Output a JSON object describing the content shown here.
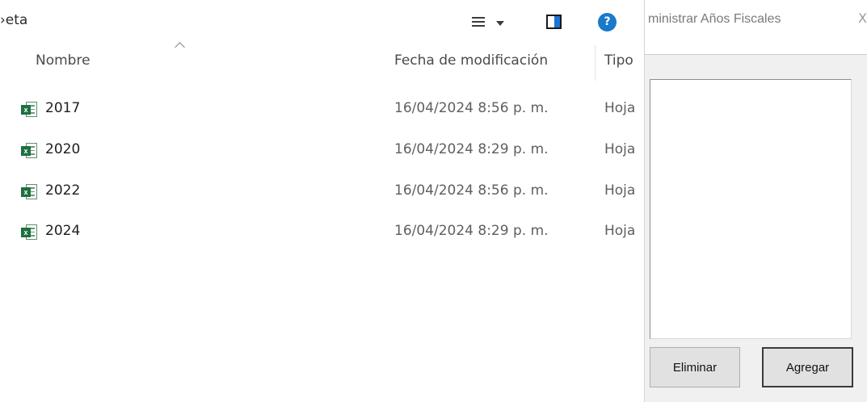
{
  "explorer": {
    "breadcrumb_fragment": "›eta",
    "toolbar": {
      "view_menu_icon": "list-view-icon",
      "preview_pane_icon": "preview-pane-icon",
      "help_label": "?"
    },
    "columns": {
      "name": "Nombre",
      "modified": "Fecha de modificación",
      "type": "Tipo"
    },
    "files": [
      {
        "icon": "excel-file-icon",
        "badge": "x",
        "name": "2017",
        "modified": "16/04/2024 8:56 p. m.",
        "type": "Hoja"
      },
      {
        "icon": "excel-file-icon",
        "badge": "x",
        "name": "2020",
        "modified": "16/04/2024 8:29 p. m.",
        "type": "Hoja"
      },
      {
        "icon": "excel-file-icon",
        "badge": "x",
        "name": "2022",
        "modified": "16/04/2024 8:56 p. m.",
        "type": "Hoja"
      },
      {
        "icon": "excel-file-icon",
        "badge": "x",
        "name": "2024",
        "modified": "16/04/2024 8:29 p. m.",
        "type": "Hoja"
      }
    ]
  },
  "dialog": {
    "title": "ministrar Años Fiscales",
    "close_label": "X",
    "listbox_items": [],
    "buttons": {
      "delete": "Eliminar",
      "add": "Agregar"
    }
  }
}
